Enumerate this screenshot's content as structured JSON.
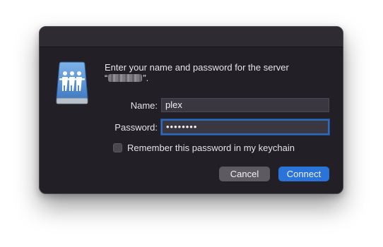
{
  "prompt": {
    "line1": "Enter your name and password for the server",
    "open_quote": "“",
    "close_quote": "”."
  },
  "form": {
    "name_label": "Name:",
    "name_value": "plex",
    "password_label": "Password:",
    "password_value": "••••••••"
  },
  "checkbox": {
    "label": "Remember this password in my keychain",
    "checked": false
  },
  "buttons": {
    "cancel": "Cancel",
    "connect": "Connect"
  },
  "icons": {
    "server": "shared-server-icon"
  },
  "colors": {
    "dialog_bg": "#221f26",
    "accent": "#2a73d9",
    "focus_ring": "#2f6bb8"
  }
}
